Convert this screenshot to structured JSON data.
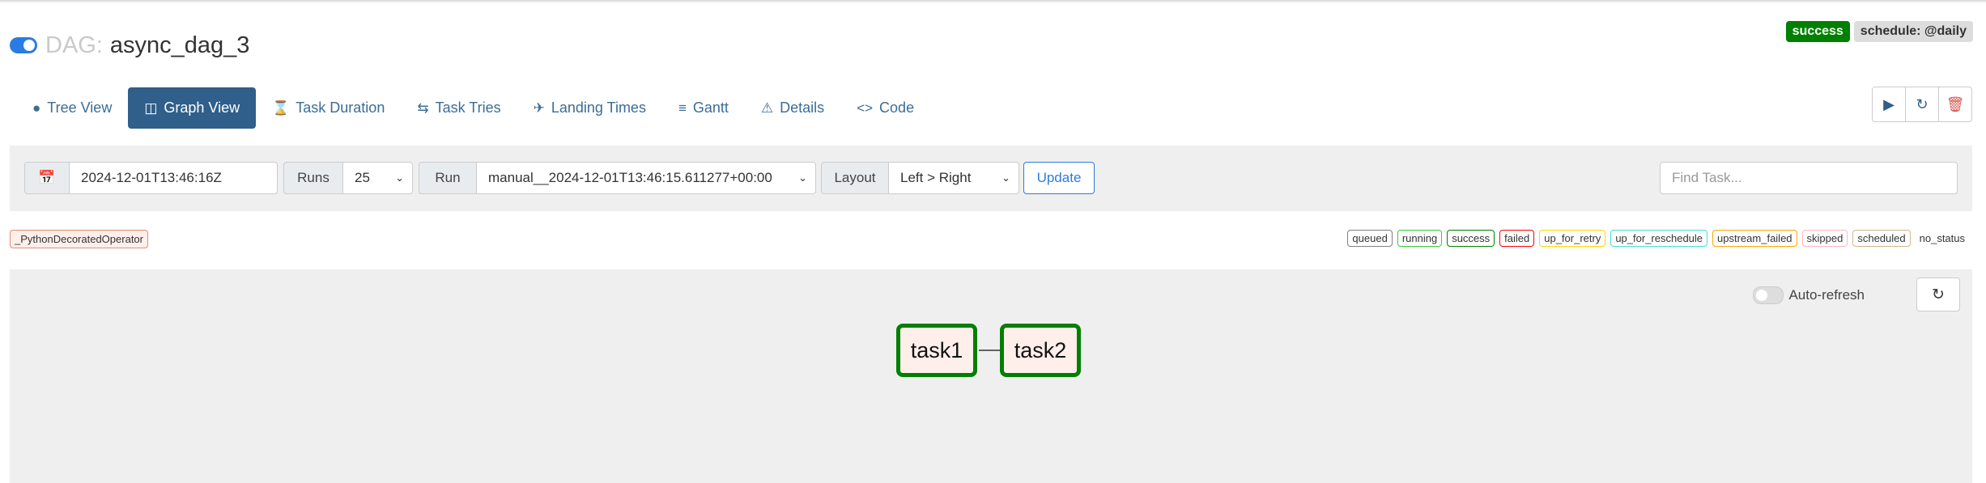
{
  "header": {
    "dag_prefix": "DAG:",
    "dag_id": "async_dag_3",
    "status_badge": "success",
    "schedule_badge": "schedule: @daily"
  },
  "tabs": [
    {
      "label": "Tree View",
      "icon": "tree-icon"
    },
    {
      "label": "Graph View",
      "icon": "graph-icon",
      "active": true
    },
    {
      "label": "Task Duration",
      "icon": "hourglass-icon"
    },
    {
      "label": "Task Tries",
      "icon": "retry-icon"
    },
    {
      "label": "Landing Times",
      "icon": "plane-landing-icon"
    },
    {
      "label": "Gantt",
      "icon": "gantt-icon"
    },
    {
      "label": "Details",
      "icon": "warning-icon"
    },
    {
      "label": "Code",
      "icon": "code-icon"
    }
  ],
  "filter": {
    "date_value": "2024-12-01T13:46:16Z",
    "runs_label": "Runs",
    "runs_value": "25",
    "run_label": "Run",
    "run_value": "manual__2024-12-01T13:46:15.611277+00:00",
    "layout_label": "Layout",
    "layout_value": "Left > Right",
    "update_label": "Update",
    "find_placeholder": "Find Task..."
  },
  "legend": {
    "operator": "_PythonDecoratedOperator",
    "statuses": [
      {
        "label": "queued",
        "color": "#808080"
      },
      {
        "label": "running",
        "color": "#32cd32"
      },
      {
        "label": "success",
        "color": "#008000"
      },
      {
        "label": "failed",
        "color": "#ff0000"
      },
      {
        "label": "up_for_retry",
        "color": "#ffd700"
      },
      {
        "label": "up_for_reschedule",
        "color": "#40e0d0"
      },
      {
        "label": "upstream_failed",
        "color": "#ffa500"
      },
      {
        "label": "skipped",
        "color": "#ffb6c1"
      },
      {
        "label": "scheduled",
        "color": "#d2b48c"
      },
      {
        "label": "no_status",
        "color": ""
      }
    ]
  },
  "graph": {
    "auto_refresh_label": "Auto-refresh",
    "nodes": [
      {
        "label": "task1"
      },
      {
        "label": "task2"
      }
    ]
  }
}
